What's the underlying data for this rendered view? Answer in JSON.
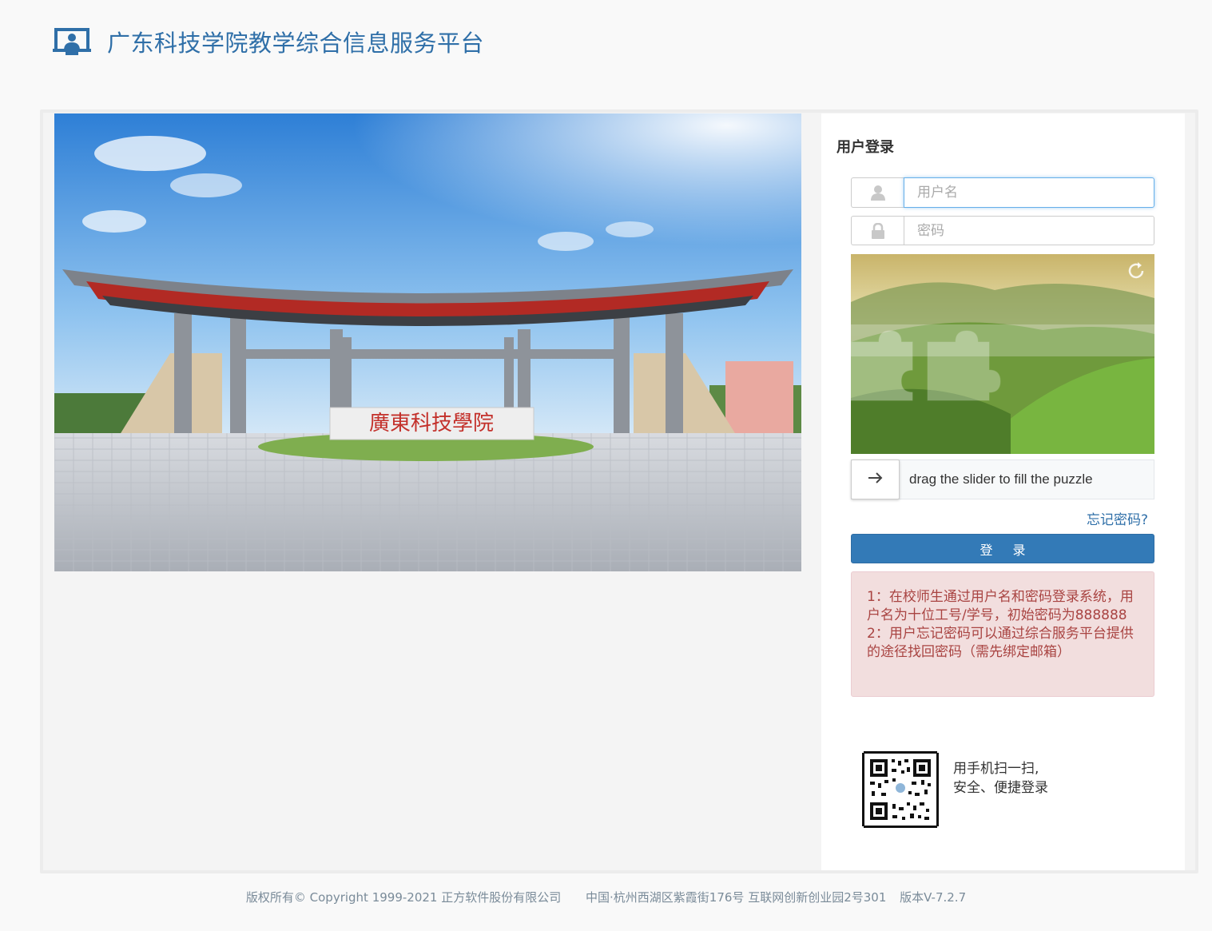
{
  "header": {
    "title": "广东科技学院教学综合信息服务平台",
    "logo_icon": "screen-user-icon"
  },
  "banner": {
    "sign_text": "廣東科技學院"
  },
  "login": {
    "title": "用户登录",
    "username_placeholder": "用户名",
    "password_placeholder": "密码",
    "user_icon": "user-icon",
    "lock_icon": "lock-icon",
    "refresh_icon": "refresh-icon",
    "slider_icon": "arrow-right-icon",
    "slider_text": "drag the slider to fill the puzzle",
    "forgot_link": "忘记密码?",
    "submit_label": "登 录",
    "notice_lines": [
      "1：在校师生通过用户名和密码登录系统，用户名为十位工号/学号，初始密码为888888",
      "2：用户忘记密码可以通过综合服务平台提供的途径找回密码（需先绑定邮箱）"
    ],
    "qr_text_line1": "用手机扫一扫,",
    "qr_text_line2": "安全、便捷登录"
  },
  "footer": {
    "copyright": "版权所有© Copyright 1999-2021 正方软件股份有限公司",
    "address": "中国·杭州西湖区紫霞街176号 互联网创新创业园2号301",
    "version": "版本V-7.2.7"
  },
  "colors": {
    "brand": "#2f6fa8",
    "button": "#337ab7",
    "notice_bg": "#f2dede",
    "notice_text": "#a94442"
  }
}
